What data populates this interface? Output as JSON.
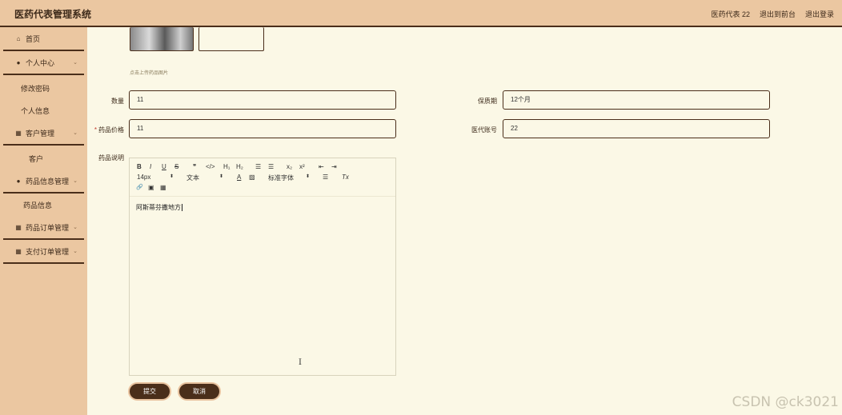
{
  "header": {
    "title": "医药代表管理系统",
    "user": "医药代表 22",
    "to_front": "退出到前台",
    "logout": "退出登录"
  },
  "sidebar": {
    "items": [
      {
        "label": "首页",
        "icon": "home-icon"
      },
      {
        "label": "个人中心",
        "icon": "user-icon",
        "children": [
          "修改密码",
          "个人信息"
        ]
      },
      {
        "label": "客户管理",
        "icon": "grid-icon",
        "children": [
          "客户"
        ]
      },
      {
        "label": "药品信息管理",
        "icon": "user-icon",
        "children": [
          "药品信息"
        ]
      },
      {
        "label": "药品订单管理",
        "icon": "grid-icon"
      },
      {
        "label": "支付订单管理",
        "icon": "grid-icon"
      }
    ]
  },
  "form": {
    "upload_hint": "点击上传药品图片",
    "quantity": {
      "label": "数量",
      "value": "11"
    },
    "shelf_life": {
      "label": "保质期",
      "value": "12个月"
    },
    "price": {
      "label": "药品价格",
      "required_mark": "*",
      "value": "11"
    },
    "rep_account": {
      "label": "医代账号",
      "value": "22"
    },
    "description": {
      "label": "药品说明",
      "content": "阿斯蒂芬撒地方"
    }
  },
  "editor_toolbar": {
    "bold": "B",
    "italic": "I",
    "underline": "U",
    "strike": "S",
    "quote": "❞",
    "code": "</>",
    "h1": "H₁",
    "h2": "H₂",
    "ol": "☰",
    "ul": "☰",
    "sub": "x₂",
    "sup": "x²",
    "outdent": "⇤",
    "indent": "⇥",
    "font_size": "14px",
    "text_type": "文本",
    "font_family": "标准字体",
    "font_color": "A",
    "bg_color": "▨",
    "align": "☰",
    "clean": "Tx",
    "link": "🔗",
    "image": "▣",
    "video": "▦"
  },
  "buttons": {
    "submit": "提交",
    "cancel": "取消"
  },
  "watermark": "CSDN @ck3021"
}
